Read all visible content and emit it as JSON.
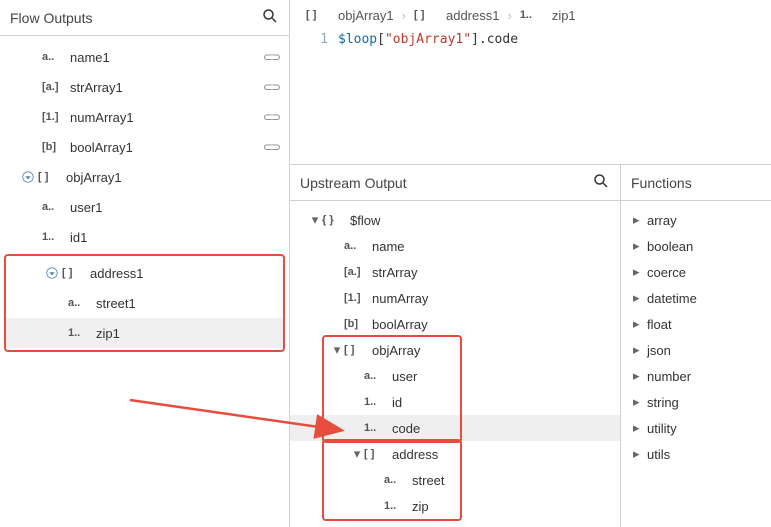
{
  "leftPanel": {
    "title": "Flow Outputs",
    "items": [
      {
        "type": "a..",
        "label": "name1",
        "indent": "indent-1",
        "link": true
      },
      {
        "type": "[a.]",
        "label": "strArray1",
        "indent": "indent-1",
        "link": true
      },
      {
        "type": "[1.]",
        "label": "numArray1",
        "indent": "indent-1",
        "link": true
      },
      {
        "type": "[b]",
        "label": "boolArray1",
        "indent": "indent-1",
        "link": true
      }
    ],
    "objArray": {
      "type": "[ ]",
      "label": "objArray1"
    },
    "objChildren": [
      {
        "type": "a..",
        "label": "user1",
        "indent": "indent-1b"
      },
      {
        "type": "1..",
        "label": "id1",
        "indent": "indent-1b"
      }
    ],
    "address": {
      "type": "[ ]",
      "label": "address1"
    },
    "addressChildren": [
      {
        "type": "a..",
        "label": "street1",
        "indent": "indent-2"
      },
      {
        "type": "1..",
        "label": "zip1",
        "indent": "indent-2",
        "selected": true
      }
    ]
  },
  "breadcrumb": [
    {
      "type": "[ ]",
      "label": "objArray1"
    },
    {
      "type": "[ ]",
      "label": "address1"
    },
    {
      "type": "1..",
      "label": "zip1"
    }
  ],
  "code": {
    "lineNo": "1",
    "var": "$loop",
    "bracketOpen": "[",
    "str": "\"objArray1\"",
    "bracketClose": "]",
    "tail": ".code"
  },
  "upstream": {
    "title": "Upstream Output",
    "flow": {
      "type": "{ }",
      "label": "$flow"
    },
    "flowChildren": [
      {
        "type": "a..",
        "label": "name",
        "indent": "u-indent-1"
      },
      {
        "type": "[a.]",
        "label": "strArray",
        "indent": "u-indent-1"
      },
      {
        "type": "[1.]",
        "label": "numArray",
        "indent": "u-indent-1"
      },
      {
        "type": "[b]",
        "label": "boolArray",
        "indent": "u-indent-1"
      }
    ],
    "objArray": {
      "type": "[ ]",
      "label": "objArray"
    },
    "objChildren": [
      {
        "type": "a..",
        "label": "user",
        "indent": "u-indent-2"
      },
      {
        "type": "1..",
        "label": "id",
        "indent": "u-indent-2"
      },
      {
        "type": "1..",
        "label": "code",
        "indent": "u-indent-2",
        "selected": true
      }
    ],
    "address": {
      "type": "[ ]",
      "label": "address"
    },
    "addressChildren": [
      {
        "type": "a..",
        "label": "street",
        "indent": "u-indent-3"
      },
      {
        "type": "1..",
        "label": "zip",
        "indent": "u-indent-3"
      }
    ]
  },
  "functions": {
    "title": "Functions",
    "items": [
      "array",
      "boolean",
      "coerce",
      "datetime",
      "float",
      "json",
      "number",
      "string",
      "utility",
      "utils"
    ]
  }
}
